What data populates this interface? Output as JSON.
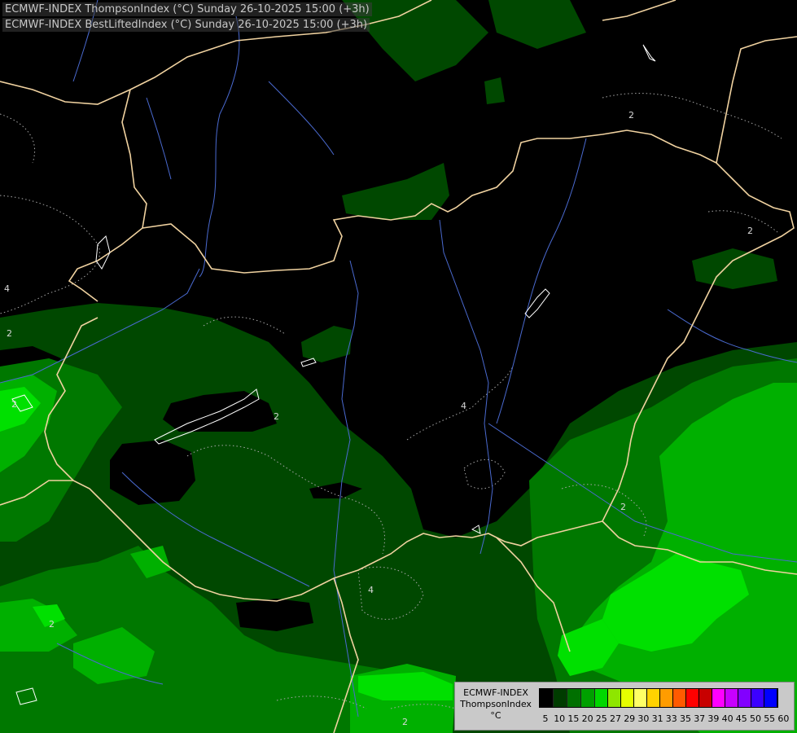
{
  "header": {
    "line1": "ECMWF-INDEX ThompsonIndex (°C) Sunday 26-10-2025 15:00 (+3h)",
    "line2": "ECMWF-INDEX BestLiftedIndex (°C) Sunday 26-10-2025 15:00 (+3h)"
  },
  "legend": {
    "model": "ECMWF-INDEX",
    "parameter": "ThompsonIndex",
    "unit": "°C",
    "colors": [
      "#000000",
      "#000000",
      "#000000",
      "#000000",
      "#003c00",
      "#007000",
      "#00a000",
      "#00d800",
      "#8ee600",
      "#e6ff00",
      "#ffff66",
      "#ffd200",
      "#ff9c00",
      "#ff5a00",
      "#ff0000",
      "#c80000",
      "#ff00ff",
      "#c800ff",
      "#8200ff",
      "#3c00ff",
      "#0000ff"
    ],
    "ticks": [
      "5",
      "10",
      "15",
      "20",
      "25",
      "27",
      "29",
      "30",
      "31",
      "33",
      "35",
      "37",
      "39",
      "40",
      "45",
      "50",
      "55",
      "60"
    ]
  },
  "contour_labels": [
    "2",
    "2",
    "4",
    "2",
    "2",
    "2",
    "4",
    "2",
    "2",
    "4",
    "2"
  ],
  "palette": {
    "background": "#000000",
    "level_25": "#004800",
    "level_27": "#007800",
    "level_29": "#00b000",
    "level_30": "#00e000",
    "border": "#f0d2a0",
    "river": "#4a6ad0",
    "lake_outline": "#ffffff",
    "contour": "#a0a0a0"
  }
}
